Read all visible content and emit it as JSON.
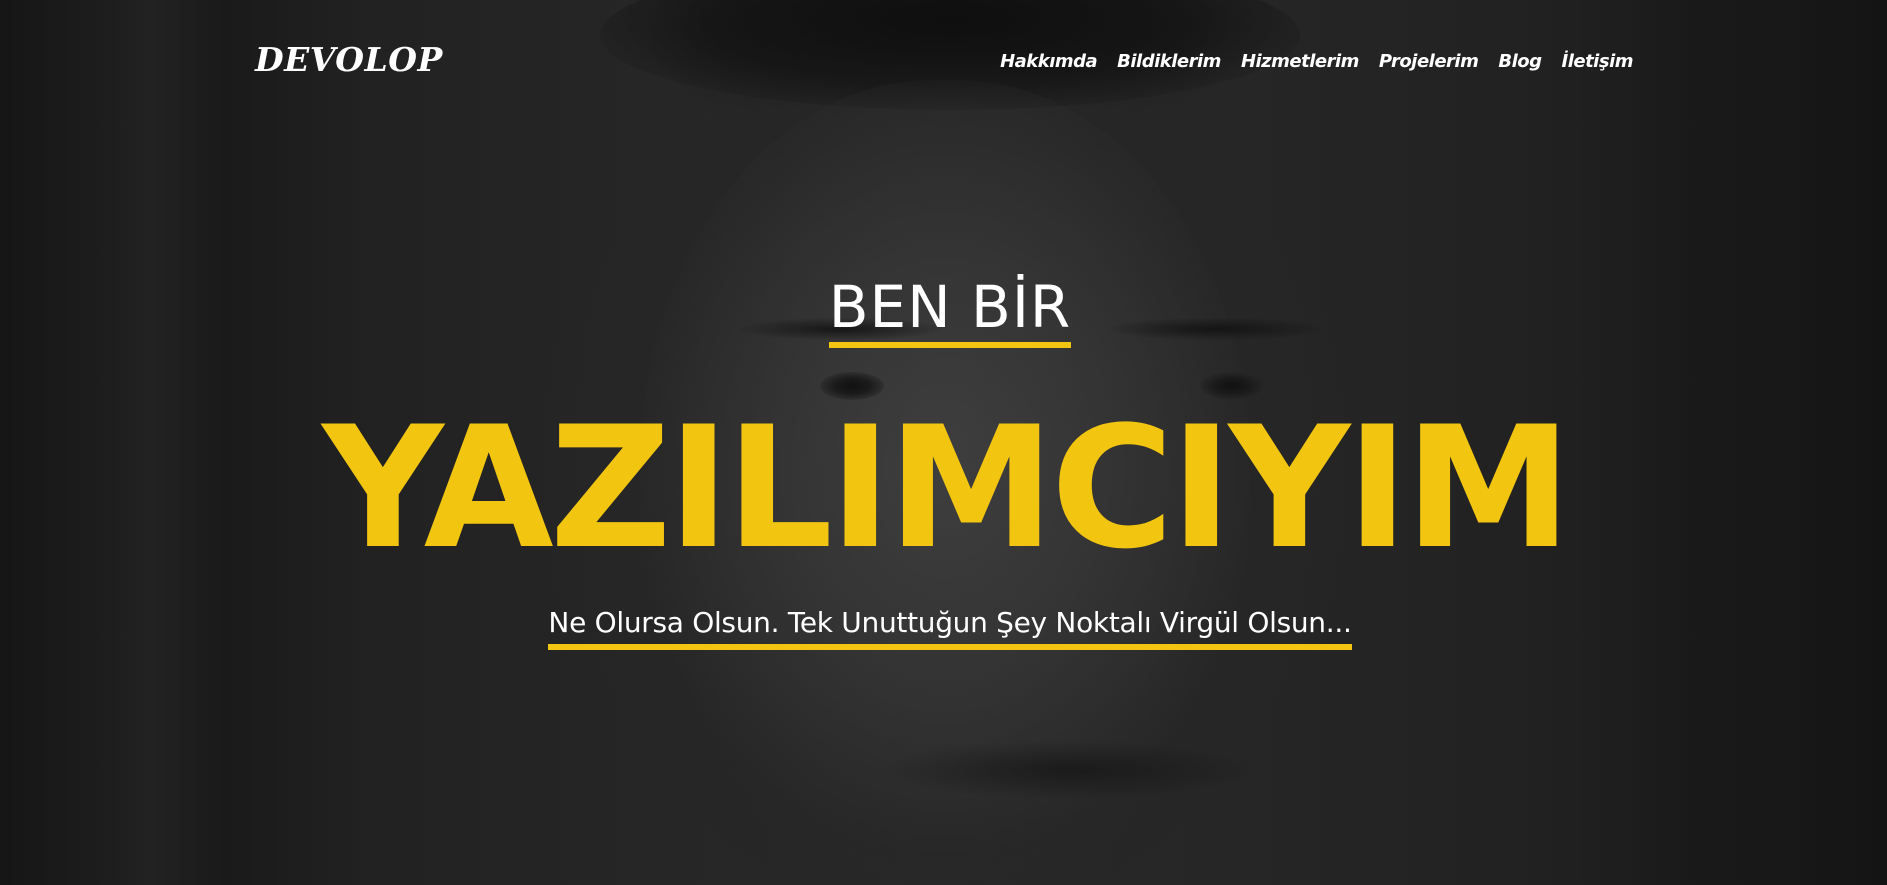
{
  "brand": {
    "logo": "DEVOLOP"
  },
  "nav": {
    "items": [
      {
        "label": "Hakkımda"
      },
      {
        "label": "Bildiklerim"
      },
      {
        "label": "Hizmetlerim"
      },
      {
        "label": "Projelerim"
      },
      {
        "label": "Blog"
      },
      {
        "label": "İletişim"
      }
    ]
  },
  "hero": {
    "kicker": "BEN BİR",
    "headline": "YAZILIMCIYIM",
    "tagline": "Ne Olursa Olsun. Tek Unuttuğun Şey Noktalı Virgül Olsun..."
  },
  "colors": {
    "accent": "#f2c510",
    "text": "#ffffff",
    "background": "#262626"
  }
}
